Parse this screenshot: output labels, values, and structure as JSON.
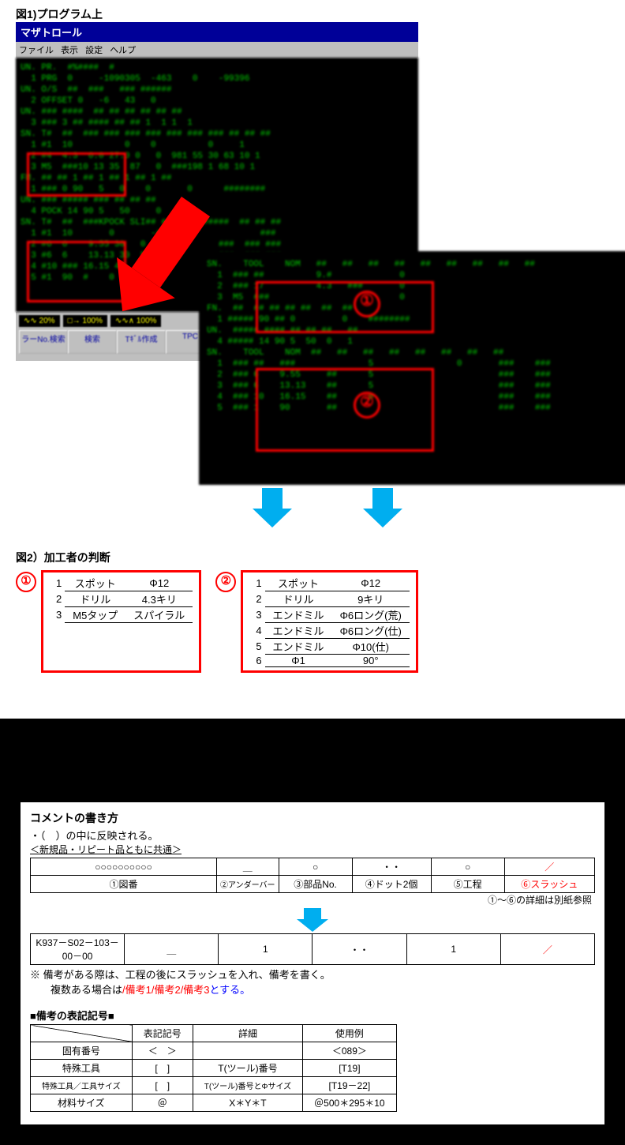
{
  "fig1": {
    "title": "図1)プログラム上"
  },
  "cnc": {
    "titlebar": "マザトロール",
    "menu": [
      "ファイル",
      "表示",
      "設定",
      "ヘルプ"
    ],
    "rows": [
      "UN. PR.  #%####  #",
      "  1 PRG  0     -1090305  -463    0    -99396",
      "",
      "UN. O/S  ##  ###   ### ######",
      "  2 OFFSET 0   -6   43   0",
      "",
      "UN. ### ####  ## ## ## ## ## ##",
      "  3 ### 3 ## #### ## ## 1  1 1  1",
      "SN. T#  ##  ### ### ### ### ### ### ### ## ## ##",
      "  1 #1  10          0    0          0     1",
      "  2 #4  4.3  6.0 27.0 0   0  981 55 30 63 10 1",
      "  3 M5  ###10 13 35  87   0  ###198 1 68 10 1",
      "FM. ## ## 1 ## 1 ## 1 ## 1 ##",
      "  1 ### 0 90   5   0    0       0      ########",
      "",
      "UN. ### ##### ### ## ## ##",
      "  4 POCK 14 90 5   50     0    1",
      "SN. T#  ##  ###KPOCK SLI## #####   #####  ## ## ##",
      "  1 #1  10       0       -###                 ###",
      "  2 #6  6    9.55 30   0   50         ###  ### ###",
      "  3 #6  6    13.13 30  5   0          ###  ### ###",
      "  4 #10 ### 16.15 45   6   0          ###  ### ###",
      "  5 #1  90  #    0   0",
      ""
    ],
    "foot_wave": [
      "∿∿ 20%",
      "□→ 100%",
      "∿∿∧ 100%"
    ],
    "foot_btns": [
      "ラーNo.検索",
      "検索",
      "Tｷﾞﾙ作成",
      "TPC"
    ]
  },
  "zoom": {
    "rows": [
      "SN.    TOOL    NOM   ##   ##   ##   ##   ##   ##   ##   ##   ##",
      "  1  ### ##          9.#             0",
      "  2  ### 17          4.3   ###       0",
      "  3  M5  ###                         0",
      "",
      "FN.  ##  ## ## ## ##  ##  ##",
      "  1 ##### 90 ## 0         0    ########",
      "",
      "UN.  ##### #### ## ## ##   ##",
      "  4 ##### 14 90 5  50  0   1",
      "SN.    TOOL    NOM  ##   ##   ##   ##   ##   ##   ##   ##",
      "  1  ### ##   ###              5                0       ###    ###",
      "  2  ### 6    9.55     ##      5                        ###    ###",
      "  3  ### 6    13.13    ##      5                        ###    ###",
      "  4  ### 10   16.15    ##      6                        ###    ###",
      "  5  ### 1    90       ##                               ###    ###"
    ],
    "badge1": "①",
    "badge2": "②"
  },
  "fig2": {
    "title": "図2）加工者の判断",
    "left": [
      {
        "n": "1",
        "a": "スポット",
        "b": "Φ12"
      },
      {
        "n": "2",
        "a": "ドリル",
        "b": "4.3キリ"
      },
      {
        "n": "3",
        "a": "M5タップ",
        "b": "スパイラル"
      }
    ],
    "right": [
      {
        "n": "1",
        "a": "スポット",
        "b": "Φ12"
      },
      {
        "n": "2",
        "a": "ドリル",
        "b": "9キリ"
      },
      {
        "n": "3",
        "a": "エンドミル",
        "b": "Φ6ロング(荒)"
      },
      {
        "n": "4",
        "a": "エンドミル",
        "b": "Φ6ロング(仕)"
      },
      {
        "n": "5",
        "a": "エンドミル",
        "b": "Φ10(仕)"
      },
      {
        "n": "6",
        "a": "Φ1",
        "b": "90°"
      }
    ],
    "b1": "①",
    "b2": "②"
  },
  "comment": {
    "heading": "コメントの書き方",
    "line1": "・（　）の中に反映される。",
    "line2": "＜新規品・リピート品ともに共通＞",
    "hdr_row1": [
      "○○○○○○○○○○",
      "＿",
      "○",
      "・・",
      "○",
      "／"
    ],
    "hdr_row2": [
      "①図番",
      "②アンダーバー",
      "③部品No.",
      "④ドット2個",
      "⑤工程",
      "⑥スラッシュ"
    ],
    "detail_ref": "①～⑥の詳細は別紙参照",
    "example": [
      "K937－S02－103－00－00",
      "＿",
      "1",
      "・・",
      "1",
      "／"
    ],
    "note_main": "※ 備考がある際は、工程の後にスラッシュを入れ、備考を書く。",
    "note_sub_prefix": "　　複数ある場合は",
    "note_sub_red": "/備考1/備考2/備考3",
    "note_sub_suffix": "とする。",
    "remark_title": "■備考の表記記号■",
    "remark_hdr": [
      "",
      "表記記号",
      "詳細",
      "使用例"
    ],
    "remarks": [
      {
        "a": "固有番号",
        "b": "＜　＞",
        "c": "",
        "d": "＜089＞"
      },
      {
        "a": "特殊工具",
        "b": "[　]",
        "c": "T(ツール)番号",
        "d": "[T19]"
      },
      {
        "a": "特殊工具／工具サイズ",
        "b": "[　]",
        "c": "T(ツール)番号とΦサイズ",
        "d": "[T19－22]",
        "small": true
      },
      {
        "a": "材料サイズ",
        "b": "＠",
        "c": "X＊Y＊T",
        "d": "＠500＊295＊10"
      }
    ]
  }
}
